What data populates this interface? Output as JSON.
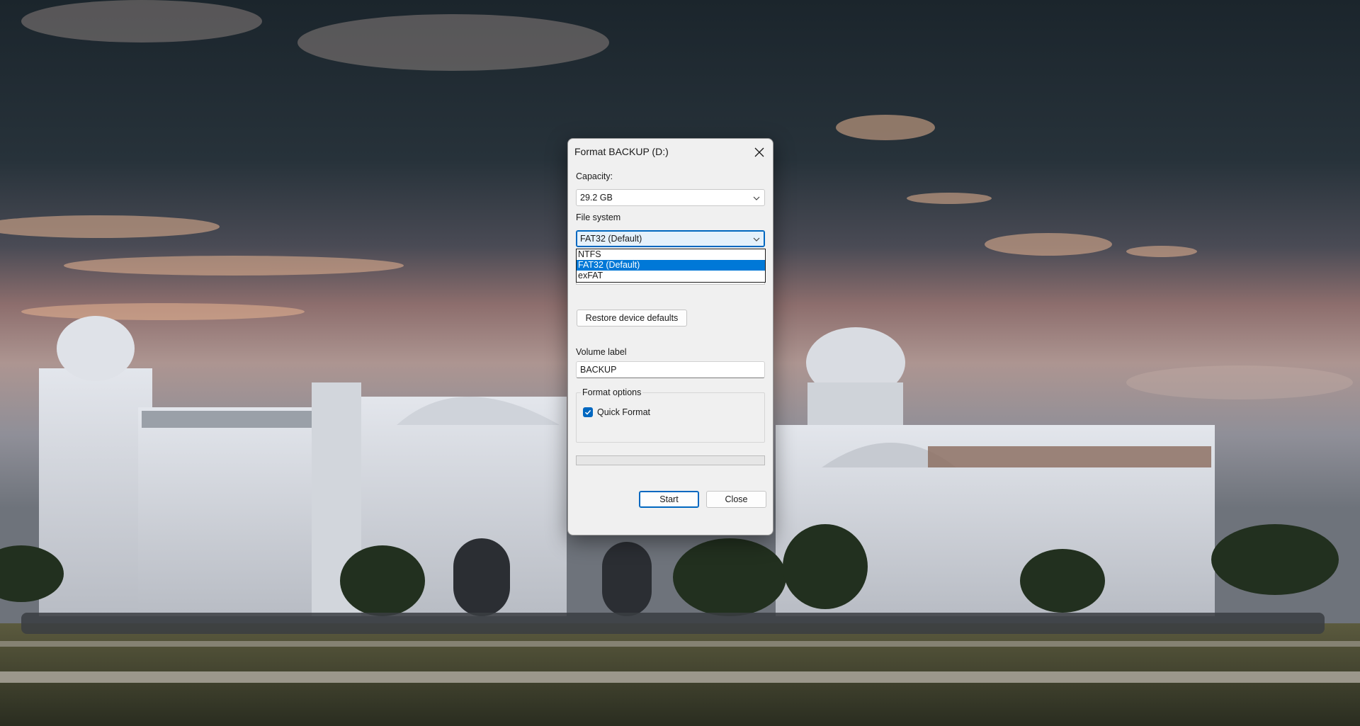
{
  "dialog": {
    "title": "Format BACKUP (D:)",
    "capacity_label": "Capacity:",
    "capacity_value": "29.2 GB",
    "file_system_label": "File system",
    "file_system_value": "FAT32 (Default)",
    "file_system_options": [
      "NTFS",
      "FAT32 (Default)",
      "exFAT"
    ],
    "selected_option_index": 1,
    "restore_button": "Restore device defaults",
    "volume_label_label": "Volume label",
    "volume_label_value": "BACKUP",
    "format_options_title": "Format options",
    "quick_format_label": "Quick Format",
    "quick_format_checked": true,
    "progress_percent": 0,
    "start_button": "Start",
    "close_button": "Close"
  },
  "colors": {
    "accent": "#0067c0",
    "selection": "#0078d7",
    "dialog_bg": "#f0f0f0"
  },
  "icons": {
    "close": "close-icon",
    "dropdown": "chevron-down-icon",
    "check": "checkmark-icon"
  }
}
